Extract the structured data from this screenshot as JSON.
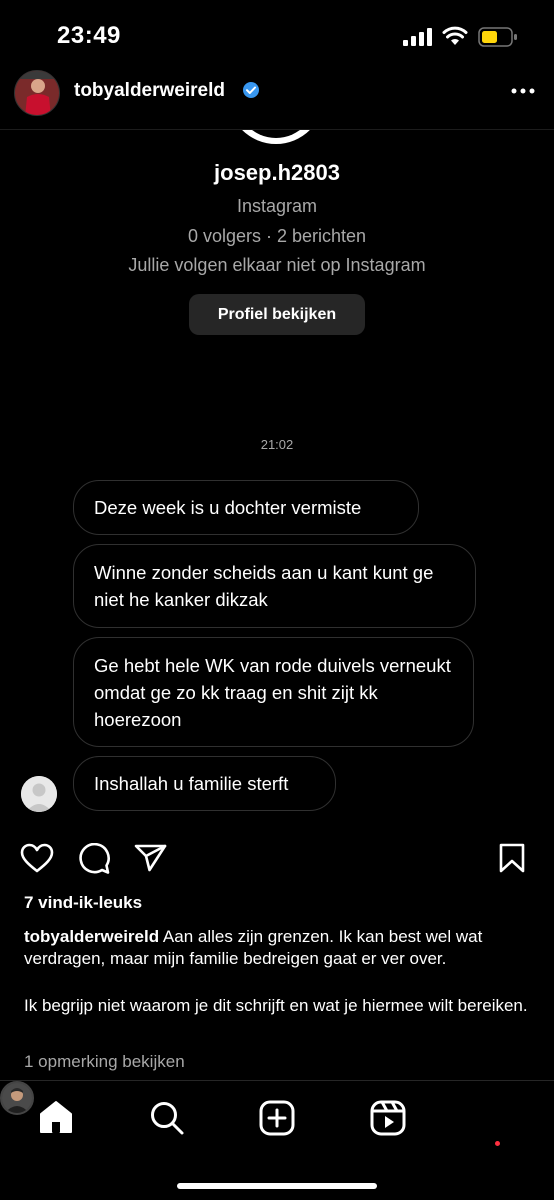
{
  "status_bar": {
    "time": "23:49"
  },
  "post": {
    "author": "tobyalderweireld",
    "verified": true
  },
  "dm": {
    "username": "josep.h2803",
    "platform": "Instagram",
    "stats": "0 volgers · 2 berichten",
    "follow_status": "Jullie volgen elkaar niet op Instagram",
    "profile_button": "Profiel bekijken",
    "timestamp": "21:02",
    "messages": [
      "Deze week is u dochter vermiste",
      "Winne zonder scheids aan u kant kunt ge niet he kanker dikzak",
      "Ge hebt hele WK van rode duivels verneukt omdat ge zo kk traag en shit zijt kk hoerezoon",
      "Inshallah u familie sterft"
    ]
  },
  "engagement": {
    "likes": "7 vind-ik-leuks",
    "caption_user": "tobyalderweireld",
    "caption_text": "Aan alles zijn grenzen. Ik kan best wel wat verdragen, maar mijn familie bedreigen gaat er ver over.",
    "caption_text_2": "Ik begrijp niet waarom je dit schrijft en wat je hiermee wilt bereiken.",
    "view_comments": "1 opmerking bekijken"
  },
  "icons": {
    "verified": "verified-badge-icon",
    "more": "more-options-icon",
    "like": "heart-icon",
    "comment": "comment-icon",
    "share": "paper-plane-icon",
    "save": "bookmark-icon",
    "home": "home-icon",
    "search": "search-icon",
    "create": "plus-square-icon",
    "reels": "reels-icon"
  },
  "colors": {
    "background": "#000000",
    "secondary_text": "#a8a8a8",
    "verified_blue": "#3897f0",
    "notification_red": "#ff3040",
    "battery_yellow": "#ffd60a"
  }
}
